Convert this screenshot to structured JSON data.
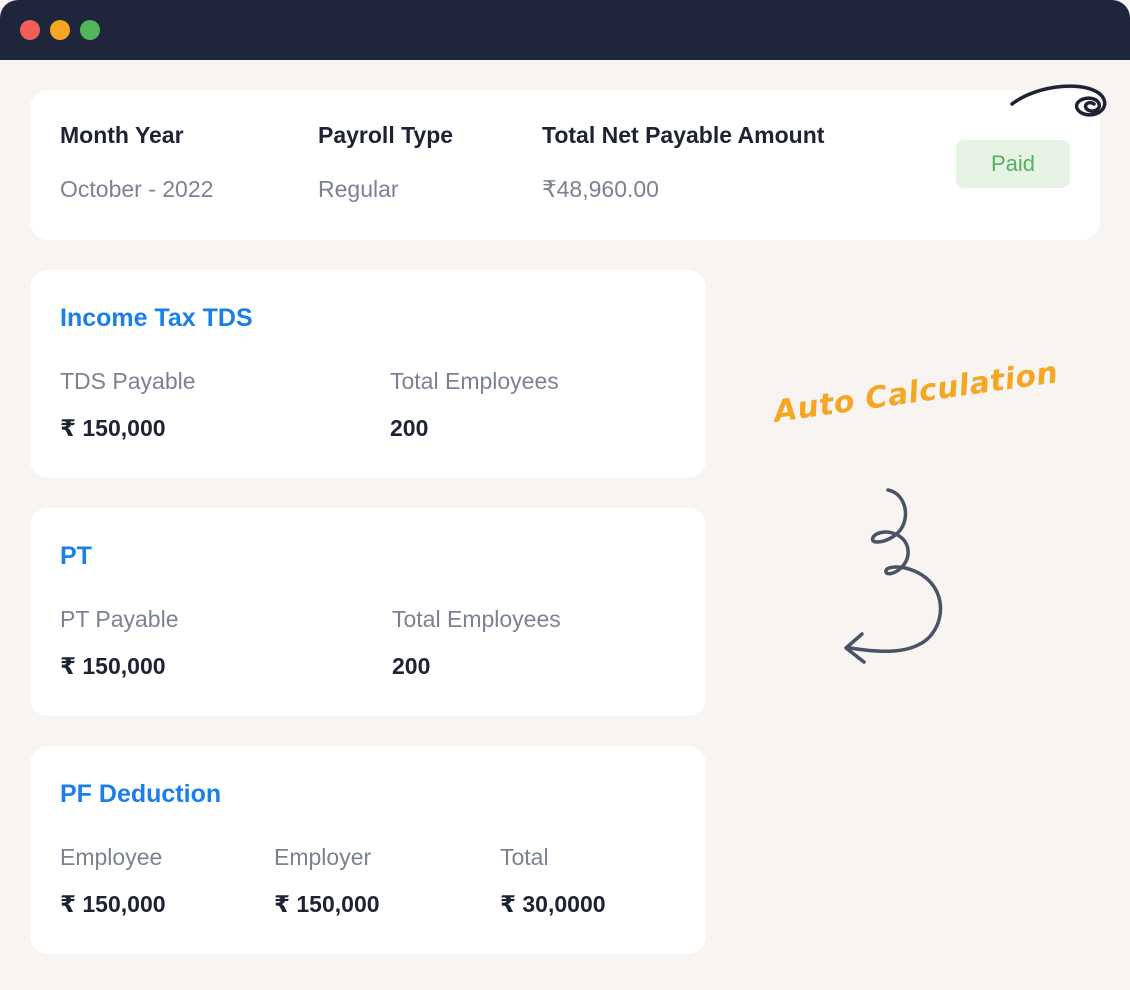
{
  "window": {
    "colors": {
      "titlebar": "#1f263b",
      "close": "#f25f58",
      "minimize": "#f5a623",
      "maximize": "#52b45b"
    }
  },
  "summary": {
    "month_year": {
      "label": "Month Year",
      "value": "October - 2022"
    },
    "payroll_type": {
      "label": "Payroll Type",
      "value": "Regular"
    },
    "total_net": {
      "label": "Total Net Payable Amount",
      "value": "₹48,960.00"
    },
    "status": "Paid"
  },
  "income_tax": {
    "title": "Income Tax TDS",
    "tds_payable": {
      "label": "TDS Payable",
      "value": "₹ 150,000"
    },
    "total_employees": {
      "label": "Total Employees",
      "value": "200"
    }
  },
  "pt": {
    "title": "PT",
    "pt_payable": {
      "label": "PT Payable",
      "value": "₹ 150,000"
    },
    "total_employees": {
      "label": "Total Employees",
      "value": "200"
    }
  },
  "pf": {
    "title": "PF Deduction",
    "employee": {
      "label": "Employee",
      "value": "₹ 150,000"
    },
    "employer": {
      "label": "Employer",
      "value": "₹ 150,000"
    },
    "total": {
      "label": "Total",
      "value": "₹ 30,0000"
    }
  },
  "annotation": {
    "text": "Auto Calculation",
    "color": "#f5a623"
  },
  "icons": [
    "swirl-icon",
    "curly-arrow-icon"
  ],
  "colors": {
    "accent": "#1b7fe8",
    "paid_bg": "#e6f3e5",
    "paid_text": "#52b45b"
  }
}
